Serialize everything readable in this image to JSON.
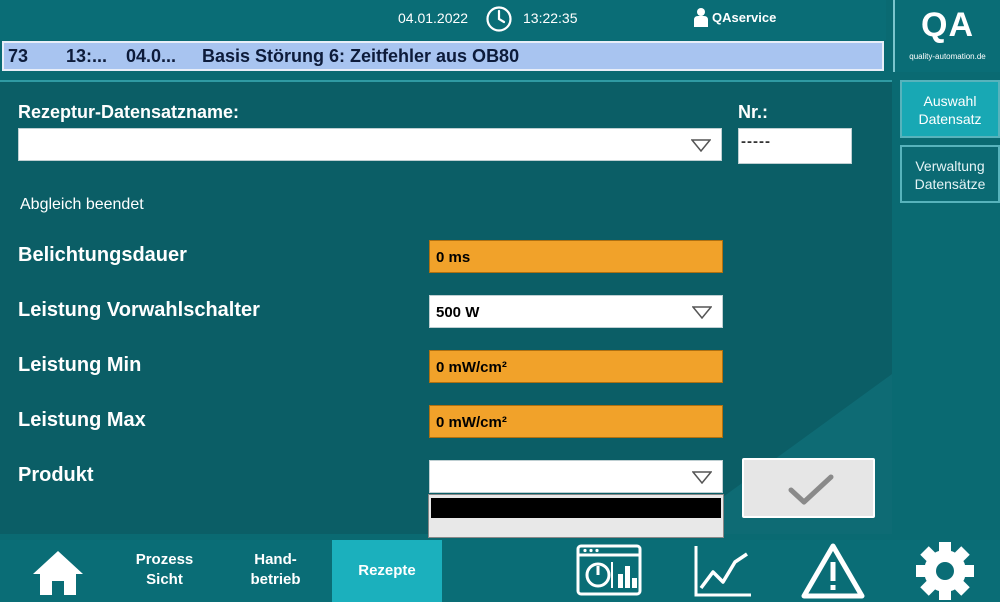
{
  "header": {
    "date": "04.01.2022",
    "time": "13:22:35",
    "user": "QAservice",
    "logo": "QA",
    "logo_url": "quality-automation.de"
  },
  "alarm": {
    "number": "73",
    "time": "13:...",
    "date": "04.0...",
    "message": "Basis Störung 6: Zeitfehler aus OB80"
  },
  "form": {
    "recipe_name_label": "Rezeptur-Datensatzname:",
    "recipe_name_value": "",
    "nr_label": "Nr.:",
    "nr_value": "-----",
    "status": "Abgleich beendet",
    "exposure_label": "Belichtungsdauer",
    "exposure_value": "0 ms",
    "power_preset_label": "Leistung Vorwahlschalter",
    "power_preset_value": "500 W",
    "power_min_label": "Leistung Min",
    "power_min_value": "0 mW/cm²",
    "power_max_label": "Leistung Max",
    "power_max_value": "0 mW/cm²",
    "product_label": "Produkt",
    "product_value": ""
  },
  "side_buttons": [
    {
      "line1": "Auswahl",
      "line2": "Datensatz",
      "active": true
    },
    {
      "line1": "Verwaltung",
      "line2": "Datensätze",
      "active": false
    }
  ],
  "nav": {
    "process_line1": "Prozess",
    "process_line2": "Sicht",
    "manual_line1": "Hand-",
    "manual_line2": "betrieb",
    "recipes": "Rezepte"
  },
  "colors": {
    "background": "#0a6a72",
    "panel": "#0b5e66",
    "alarm_bar": "#a8c4f0",
    "orange_field": "#f1a22a",
    "active_nav": "#1bb0bd"
  },
  "icons": [
    "clock-icon",
    "user-icon",
    "dropdown-arrow-icon",
    "checkmark-icon",
    "home-icon",
    "dashboard-icon",
    "trend-chart-icon",
    "warning-icon",
    "gear-icon"
  ]
}
